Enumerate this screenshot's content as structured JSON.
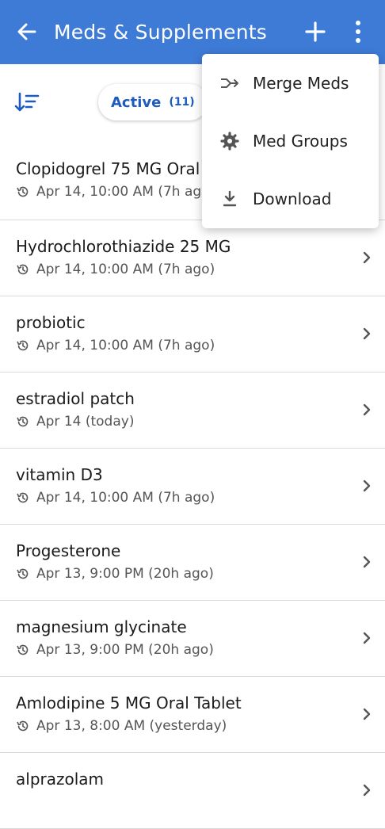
{
  "header": {
    "title": "Meds & Supplements",
    "back_icon": "arrow-left-icon",
    "add_icon": "plus-icon",
    "more_icon": "more-vertical-icon",
    "color": "#3e7bd6"
  },
  "filter": {
    "sort_icon": "sort-icon",
    "chip_label": "Active",
    "chip_count": "(11)"
  },
  "menu": {
    "items": [
      {
        "label": "Merge Meds",
        "icon": "merge-icon"
      },
      {
        "label": "Med Groups",
        "icon": "gear-icon"
      },
      {
        "label": "Download",
        "icon": "download-icon"
      }
    ]
  },
  "meds": [
    {
      "name": "Clopidogrel 75 MG Oral Tablet",
      "time": "Apr 14, 10:00 AM (7h ago)"
    },
    {
      "name": "Hydrochlorothiazide 25 MG",
      "time": "Apr 14, 10:00 AM (7h ago)"
    },
    {
      "name": "probiotic",
      "time": "Apr 14, 10:00 AM (7h ago)"
    },
    {
      "name": "estradiol patch",
      "time": "Apr 14 (today)"
    },
    {
      "name": "vitamin D3",
      "time": "Apr 14, 10:00 AM (7h ago)"
    },
    {
      "name": "Progesterone",
      "time": "Apr 13, 9:00 PM (20h ago)"
    },
    {
      "name": "magnesium glycinate",
      "time": "Apr 13, 9:00 PM (20h ago)"
    },
    {
      "name": "Amlodipine 5 MG Oral Tablet",
      "time": "Apr 13, 8:00 AM (yesterday)"
    },
    {
      "name": "alprazolam",
      "time": ""
    }
  ]
}
